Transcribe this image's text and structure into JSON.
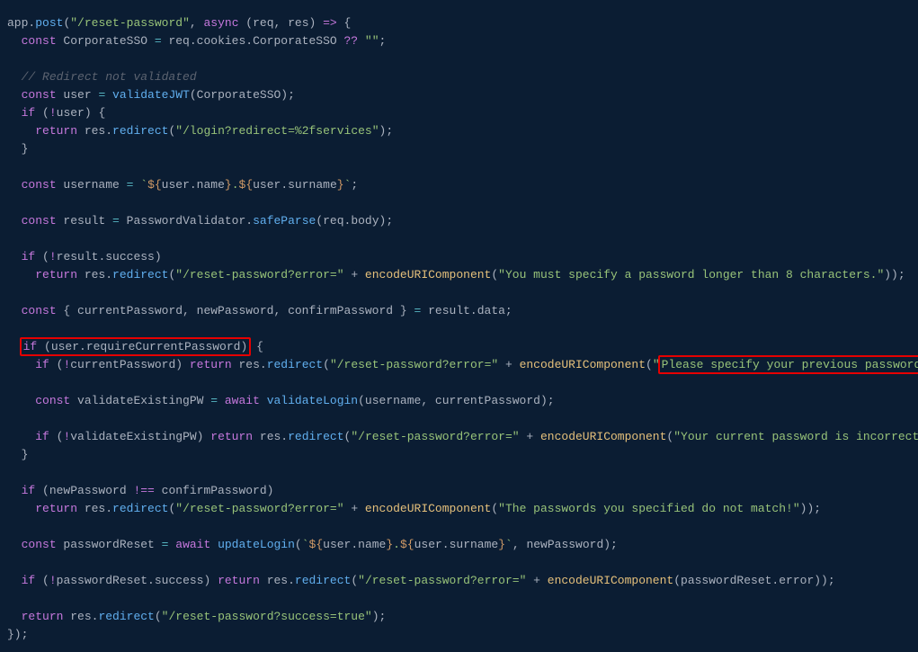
{
  "code": {
    "l1_app": "app",
    "l1_post": "post",
    "l1_route": "\"/reset-password\"",
    "l1_async": "async",
    "l1_params": " (req, res) ",
    "l1_arrow": "=>",
    "l1_brace": " {",
    "l2_const": "const",
    "l2_var": " CorporateSSO ",
    "l2_eq": "=",
    "l2_expr": " req.cookies.CorporateSSO ",
    "l2_nullish": "??",
    "l2_empty": " \"\"",
    "l2_semi": ";",
    "l4_comment": "// Redirect not validated",
    "l5_const": "const",
    "l5_user": " user ",
    "l5_eq": "=",
    "l5_fn": " validateJWT",
    "l5_args": "(CorporateSSO);",
    "l6_if": "if",
    "l6_open": " (",
    "l6_not": "!",
    "l6_cond": "user) {",
    "l7_return": "return",
    "l7_res": " res.",
    "l7_redirect": "redirect",
    "l7_open": "(",
    "l7_str": "\"/login?redirect=%2fservices\"",
    "l7_close": ");",
    "l8_close": "}",
    "l10_const": "const",
    "l10_var": " username ",
    "l10_eq": "=",
    "l10_bt1": " `",
    "l10_d1": "${",
    "l10_un": "user.name",
    "l10_cb1": "}",
    "l10_dot": ".",
    "l10_d2": "${",
    "l10_sn": "user.surname",
    "l10_cb2": "}",
    "l10_bt2": "`",
    "l10_semi": ";",
    "l12_const": "const",
    "l12_var": " result ",
    "l12_eq": "=",
    "l12_pv": " PasswordValidator.",
    "l12_sp": "safeParse",
    "l12_args": "(req.body);",
    "l14_if": "if",
    "l14_open": " (",
    "l14_not": "!",
    "l14_cond": "result.success)",
    "l15_return": "return",
    "l15_res": " res.",
    "l15_redirect": "redirect",
    "l15_open": "(",
    "l15_str": "\"/reset-password?error=\"",
    "l15_plus": " + ",
    "l15_enc": "encodeURIComponent",
    "l15_op2": "(",
    "l15_msg": "\"You must specify a password longer than 8 characters.\"",
    "l15_close": "));",
    "l17_const": "const",
    "l17_dest": " { currentPassword, newPassword, confirmPassword } ",
    "l17_eq": "=",
    "l17_res": " result.data;",
    "l19_if": "if",
    "l19_cond": " (user.requireCurrentPassword)",
    "l19_brace": " {",
    "l20_if": "if",
    "l20_open": " (",
    "l20_not": "!",
    "l20_cond": "currentPassword) ",
    "l20_return": "return",
    "l20_res": " res.",
    "l20_redirect": "redirect",
    "l20_op": "(",
    "l20_str": "\"/reset-password?error=\"",
    "l20_plus": " + ",
    "l20_enc": "encodeURIComponent",
    "l20_op2": "(",
    "l20_q1": "\"",
    "l20_msg": "Please specify your previous password.",
    "l20_q2": "\"",
    "l20_close": "));",
    "l22_const": "const",
    "l22_var": " validateExistingPW ",
    "l22_eq": "=",
    "l22_await": " await",
    "l22_fn": " validateLogin",
    "l22_args": "(username, currentPassword);",
    "l24_if": "if",
    "l24_open": " (",
    "l24_not": "!",
    "l24_cond": "validateExistingPW) ",
    "l24_return": "return",
    "l24_res": " res.",
    "l24_redirect": "redirect",
    "l24_op": "(",
    "l24_str": "\"/reset-password?error=\"",
    "l24_plus": " + ",
    "l24_enc": "encodeURIComponent",
    "l24_op2": "(",
    "l24_msg": "\"Your current password is incorrect.\"",
    "l24_close": "));",
    "l25_close": "}",
    "l27_if": "if",
    "l27_open": " (newPassword ",
    "l27_neq": "!==",
    "l27_close": " confirmPassword)",
    "l28_return": "return",
    "l28_res": " res.",
    "l28_redirect": "redirect",
    "l28_op": "(",
    "l28_str": "\"/reset-password?error=\"",
    "l28_plus": " + ",
    "l28_enc": "encodeURIComponent",
    "l28_op2": "(",
    "l28_msg": "\"The passwords you specified do not match!\"",
    "l28_close": "));",
    "l30_const": "const",
    "l30_var": " passwordReset ",
    "l30_eq": "=",
    "l30_await": " await",
    "l30_fn": " updateLogin",
    "l30_op": "(",
    "l30_bt1": "`",
    "l30_d1": "${",
    "l30_un": "user.name",
    "l30_cb1": "}",
    "l30_dot": ".",
    "l30_d2": "${",
    "l30_sn": "user.surname",
    "l30_cb2": "}",
    "l30_bt2": "`",
    "l30_args": ", newPassword);",
    "l32_if": "if",
    "l32_open": " (",
    "l32_not": "!",
    "l32_cond": "passwordReset.success) ",
    "l32_return": "return",
    "l32_res": " res.",
    "l32_redirect": "redirect",
    "l32_op": "(",
    "l32_str": "\"/reset-password?error=\"",
    "l32_plus": " + ",
    "l32_enc": "encodeURIComponent",
    "l32_args": "(passwordReset.error));",
    "l34_return": "return",
    "l34_res": " res.",
    "l34_redirect": "redirect",
    "l34_op": "(",
    "l34_str": "\"/reset-password?success=true\"",
    "l34_close": ");",
    "l35_close": "});"
  }
}
